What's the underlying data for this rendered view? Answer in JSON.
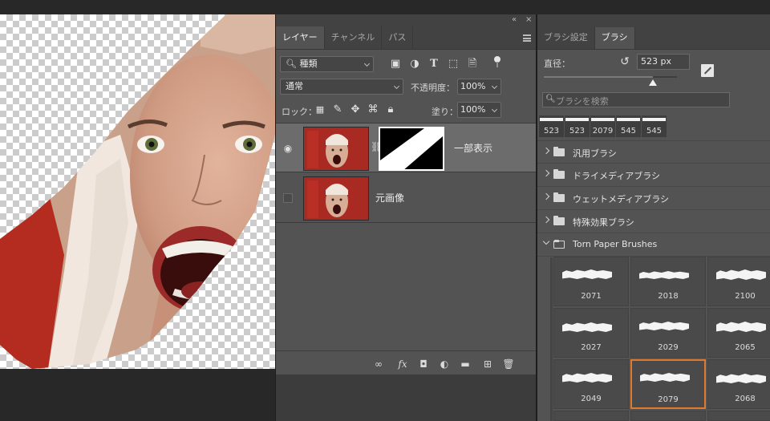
{
  "layers_panel": {
    "collapse_icon": "«",
    "close_icon": "×",
    "tabs": [
      {
        "label": "レイヤー",
        "active": true
      },
      {
        "label": "チャンネル",
        "active": false
      },
      {
        "label": "パス",
        "active": false
      }
    ],
    "filter_kind": "種類",
    "blend_mode": "通常",
    "opacity_label": "不透明度：",
    "opacity_value": "100%",
    "lock_label": "ロック：",
    "fill_label": "塗り：",
    "fill_value": "100%",
    "layers": [
      {
        "name": "一部表示",
        "visible": true,
        "selected": true,
        "has_mask": true
      },
      {
        "name": "元画像",
        "visible": false,
        "selected": false,
        "has_mask": false
      }
    ],
    "bottom_icons": [
      "link-layers-icon",
      "fx-icon",
      "add-mask-icon",
      "adjustment-layer-icon",
      "group-folder-icon",
      "new-layer-icon",
      "trash-icon"
    ]
  },
  "brush_panel": {
    "tabs": [
      {
        "label": "ブラシ設定",
        "active": false
      },
      {
        "label": "ブラシ",
        "active": true
      }
    ],
    "size_label": "直径：",
    "size_value": "523 px",
    "size_fraction": 0.82,
    "search_placeholder": "ブラシを検索",
    "recent_brushes": [
      "523",
      "523",
      "2079",
      "545",
      "545"
    ],
    "groups": [
      {
        "name": "汎用ブラシ",
        "open": false
      },
      {
        "name": "ドライメディアブラシ",
        "open": false
      },
      {
        "name": "ウェットメディアブラシ",
        "open": false
      },
      {
        "name": "特殊効果ブラシ",
        "open": false
      },
      {
        "name": "Torn Paper Brushes",
        "open": true
      }
    ],
    "torn_paper_brushes": [
      {
        "num": "2071",
        "selected": false
      },
      {
        "num": "2018",
        "selected": false
      },
      {
        "num": "2100",
        "selected": false
      },
      {
        "num": "2027",
        "selected": false
      },
      {
        "num": "2029",
        "selected": false
      },
      {
        "num": "2065",
        "selected": false
      },
      {
        "num": "2049",
        "selected": false
      },
      {
        "num": "2079",
        "selected": true
      },
      {
        "num": "2068",
        "selected": false
      }
    ]
  },
  "colors": {
    "selection_accent": "#e07a2e",
    "panel_bg": "#535353",
    "app_bg": "#282828"
  }
}
